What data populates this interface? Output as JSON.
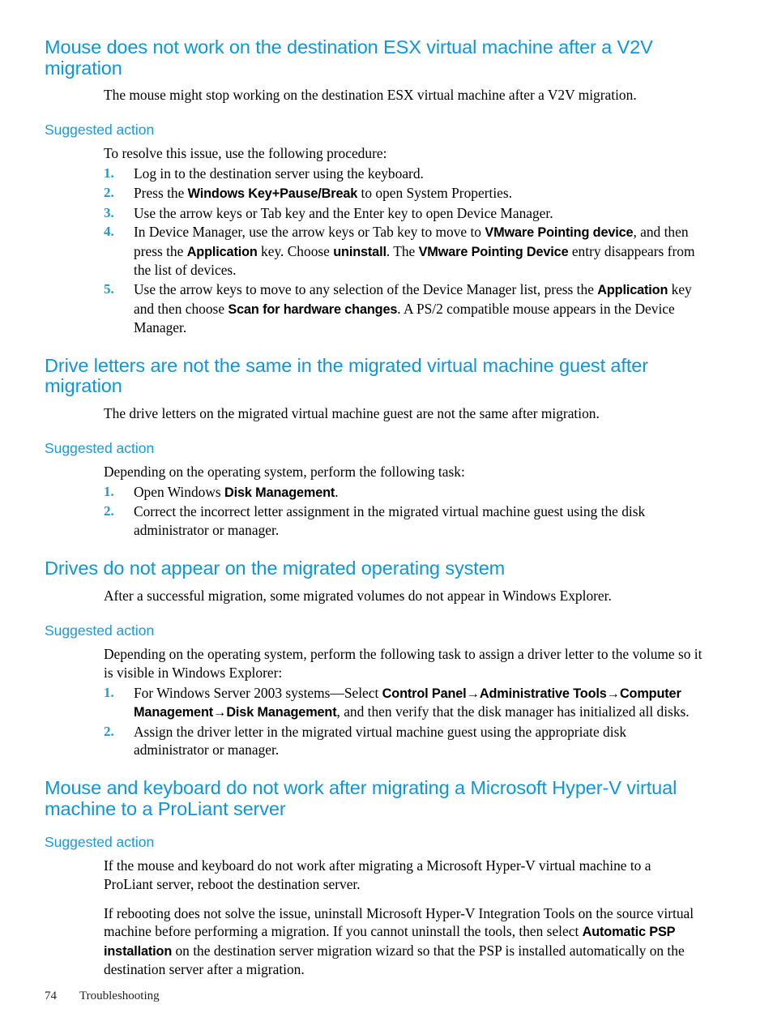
{
  "page": {
    "footer_page_number": "74",
    "footer_chapter": "Troubleshooting",
    "heading_color": "#0c97d8",
    "subheading_color": "#1b9ad9",
    "list_number_color": "#1b9ad9"
  },
  "sections": [
    {
      "title": "Mouse does not work on the destination ESX virtual machine after a V2V migration",
      "intro": "The mouse might stop working on the destination ESX virtual machine after a V2V migration.",
      "sub_title": "Suggested action",
      "lead": "To resolve this issue, use the following procedure:",
      "steps": [
        {
          "num": "1.",
          "parts": [
            {
              "t": "Log in to the destination server using the keyboard.",
              "b": false
            }
          ]
        },
        {
          "num": "2.",
          "parts": [
            {
              "t": "Press the ",
              "b": false
            },
            {
              "t": "Windows Key+Pause/Break",
              "b": true
            },
            {
              "t": " to open System Properties.",
              "b": false
            }
          ]
        },
        {
          "num": "3.",
          "parts": [
            {
              "t": "Use the arrow keys or Tab key and the Enter key to open Device Manager.",
              "b": false
            }
          ]
        },
        {
          "num": "4.",
          "parts": [
            {
              "t": "In Device Manager, use the arrow keys or Tab key to move to ",
              "b": false
            },
            {
              "t": "VMware Pointing device",
              "b": true
            },
            {
              "t": ", and then press the ",
              "b": false
            },
            {
              "t": "Application",
              "b": true
            },
            {
              "t": " key. Choose ",
              "b": false
            },
            {
              "t": "uninstall",
              "b": true
            },
            {
              "t": ". The ",
              "b": false
            },
            {
              "t": "VMware Pointing Device",
              "b": true
            },
            {
              "t": " entry disappears from the list of devices.",
              "b": false
            }
          ]
        },
        {
          "num": "5.",
          "parts": [
            {
              "t": "Use the arrow keys to move to any selection of the Device Manager list, press the ",
              "b": false
            },
            {
              "t": "Application",
              "b": true
            },
            {
              "t": " key and then choose ",
              "b": false
            },
            {
              "t": "Scan for hardware changes",
              "b": true
            },
            {
              "t": ". A PS/2 compatible mouse appears in the Device Manager.",
              "b": false
            }
          ]
        }
      ]
    },
    {
      "title": "Drive letters are not the same in the migrated virtual machine guest after migration",
      "intro": "The drive letters on the migrated virtual machine guest are not the same after migration.",
      "sub_title": "Suggested action",
      "lead": "Depending on the operating system, perform the following task:",
      "steps": [
        {
          "num": "1.",
          "parts": [
            {
              "t": "Open Windows ",
              "b": false
            },
            {
              "t": "Disk Management",
              "b": true
            },
            {
              "t": ".",
              "b": false
            }
          ]
        },
        {
          "num": "2.",
          "parts": [
            {
              "t": "Correct the incorrect letter assignment in the migrated virtual machine guest using the disk administrator or manager.",
              "b": false
            }
          ]
        }
      ]
    },
    {
      "title": "Drives do not appear on the migrated operating system",
      "intro": "After a successful migration, some migrated volumes do not appear in Windows Explorer.",
      "sub_title": "Suggested action",
      "lead": "Depending on the operating system, perform the following task to assign a driver letter to the volume so it is visible in Windows Explorer:",
      "steps": [
        {
          "num": "1.",
          "parts": [
            {
              "t": "For Windows Server 2003 systems—Select ",
              "b": false
            },
            {
              "t": "Control Panel→Administrative Tools→Computer Management→Disk Management",
              "b": true
            },
            {
              "t": ", and then verify that the disk manager has initialized all disks.",
              "b": false
            }
          ]
        },
        {
          "num": "2.",
          "parts": [
            {
              "t": "Assign the driver letter in the migrated virtual machine guest using the appropriate disk administrator or manager.",
              "b": false
            }
          ]
        }
      ]
    },
    {
      "title": "Mouse and keyboard do not work after migrating a Microsoft Hyper-V virtual machine to a ProLiant server",
      "intro": null,
      "sub_title": "Suggested action",
      "paragraphs": [
        {
          "parts": [
            {
              "t": "If the mouse and keyboard do not work after migrating a Microsoft Hyper-V virtual machine to a ProLiant server, reboot the destination server.",
              "b": false
            }
          ]
        },
        {
          "parts": [
            {
              "t": "If rebooting does not solve the issue, uninstall Microsoft Hyper-V Integration Tools on the source virtual machine before performing a migration. If you cannot uninstall the tools, then select ",
              "b": false
            },
            {
              "t": "Automatic PSP installation",
              "b": true
            },
            {
              "t": " on the destination server migration wizard so that the PSP is installed automatically on the destination server after a migration.",
              "b": false
            }
          ]
        }
      ]
    }
  ]
}
